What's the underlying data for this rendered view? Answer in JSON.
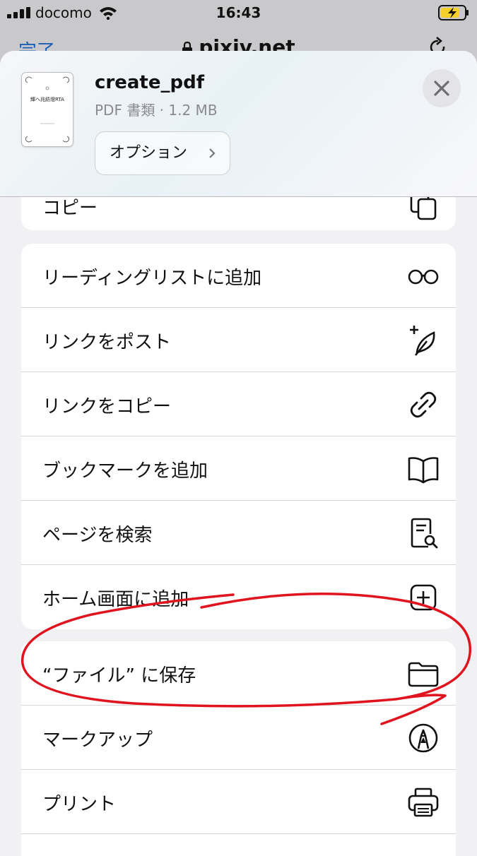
{
  "status_bar": {
    "carrier": "docomo",
    "time": "16:43"
  },
  "browser": {
    "done_label": "完了",
    "url": "pixiv.net"
  },
  "share_sheet": {
    "file_name": "create_pdf",
    "file_meta": "PDF 書類 · 1.2 MB",
    "options_label": "オプション",
    "thumbnail_title": "輝へ兆紡燈RTA",
    "partial_row_label": "コピー",
    "group1": [
      {
        "label": "リーディングリストに追加",
        "icon": "glasses-icon"
      },
      {
        "label": "リンクをポスト",
        "icon": "compose-post-icon"
      },
      {
        "label": "リンクをコピー",
        "icon": "link-icon"
      },
      {
        "label": "ブックマークを追加",
        "icon": "book-icon"
      },
      {
        "label": "ページを検索",
        "icon": "find-in-page-icon"
      },
      {
        "label": "ホーム画面に追加",
        "icon": "add-square-icon"
      }
    ],
    "group2": [
      {
        "label": "“ファイル” に保存",
        "icon": "folder-icon"
      },
      {
        "label": "マークアップ",
        "icon": "markup-pen-icon"
      },
      {
        "label": "プリント",
        "icon": "printer-icon"
      }
    ]
  },
  "colors": {
    "annotation": "#e0141e",
    "accent": "#1b5fb5",
    "battery_fill": "#f5d02b"
  }
}
